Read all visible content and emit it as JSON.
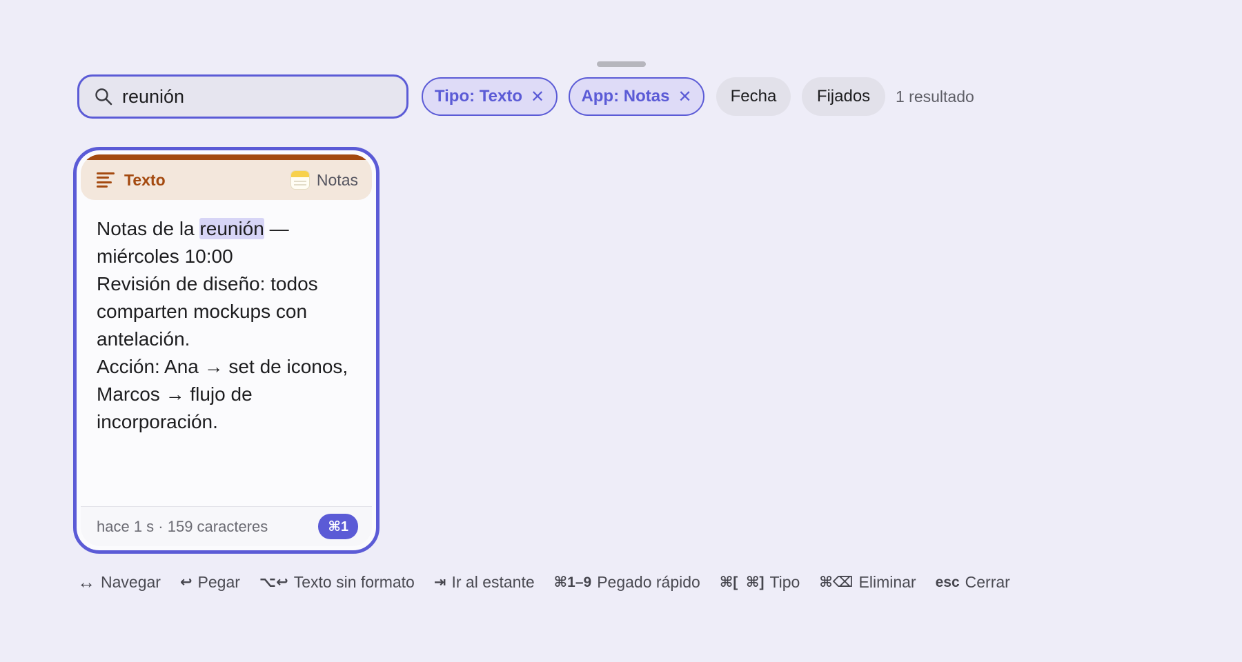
{
  "search": {
    "value": "reunión",
    "icon": "search-icon"
  },
  "filters": {
    "type_chip": "Tipo: Texto",
    "app_chip": "App: Notas",
    "remove_glyph": "✕",
    "date_chip": "Fecha",
    "pinned_chip": "Fijados",
    "result_count": "1 resultado"
  },
  "card": {
    "type_label": "Texto",
    "app_label": "Notas",
    "accent_color": "#a44a10",
    "line1_before": "Notas de la ",
    "line1_highlight": "reunión",
    "line1_after": " — miércoles 10:00",
    "line2": "Revisión de diseño: todos comparten mockups con antelación.",
    "line3": "Acción: Ana → set de iconos, Marcos → flujo de incorporación.",
    "meta": "hace 1 s · 159 caracteres",
    "shortcut": "⌘1"
  },
  "shortcuts": [
    {
      "key": "↔",
      "label": "Navegar"
    },
    {
      "key": "↩",
      "label": "Pegar"
    },
    {
      "key": "⌥↩",
      "label": "Texto sin formato"
    },
    {
      "key": "⇥",
      "label": "Ir al estante"
    },
    {
      "key": "⌘1–9",
      "label": "Pegado rápido"
    },
    {
      "key": "⌘[  ⌘]",
      "label": "Tipo"
    },
    {
      "key": "⌘⌫",
      "label": "Eliminar"
    },
    {
      "key": "esc",
      "label": "Cerrar"
    }
  ],
  "colors": {
    "accent": "#5b5bd6",
    "background": "#eeedf8"
  }
}
